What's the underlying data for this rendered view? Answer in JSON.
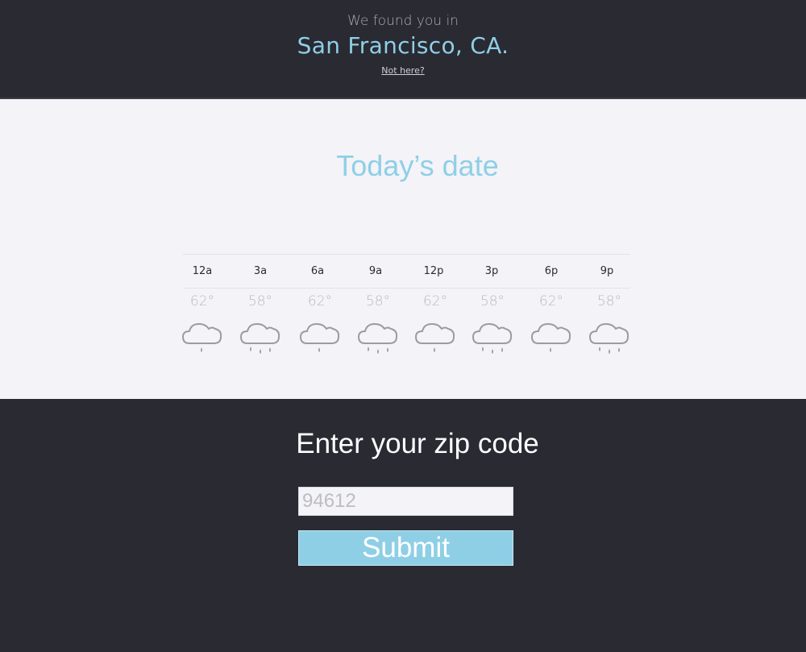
{
  "header": {
    "intro": "We found you in",
    "city": "San Francisco, CA.",
    "not_here_link": "Not here?"
  },
  "main": {
    "date_title": "Today’s date",
    "forecast": [
      {
        "hour": "12a",
        "temp": "62°",
        "icon": "cloud-light-rain-icon"
      },
      {
        "hour": "3a",
        "temp": "58°",
        "icon": "cloud-heavy-rain-icon"
      },
      {
        "hour": "6a",
        "temp": "62°",
        "icon": "cloud-light-rain-icon"
      },
      {
        "hour": "9a",
        "temp": "58°",
        "icon": "cloud-heavy-rain-icon"
      },
      {
        "hour": "12p",
        "temp": "62°",
        "icon": "cloud-light-rain-icon"
      },
      {
        "hour": "3p",
        "temp": "58°",
        "icon": "cloud-heavy-rain-icon"
      },
      {
        "hour": "6p",
        "temp": "62°",
        "icon": "cloud-light-rain-icon"
      },
      {
        "hour": "9p",
        "temp": "58°",
        "icon": "cloud-heavy-rain-icon"
      }
    ]
  },
  "zip": {
    "heading": "Enter your zip code",
    "placeholder": "94612",
    "submit_label": "Submit"
  },
  "colors": {
    "accent": "#8fcfe6",
    "dark_bg": "#2a2a33",
    "light_bg": "#f3f3f8"
  }
}
